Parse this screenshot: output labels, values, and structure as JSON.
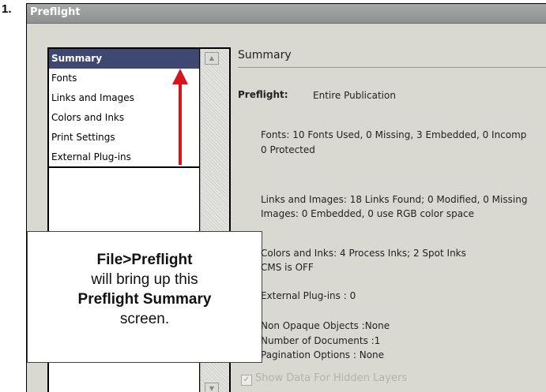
{
  "step_number": "1.",
  "window": {
    "title": "Preflight"
  },
  "sidebar": {
    "items": [
      {
        "label": "Summary"
      },
      {
        "label": "Fonts"
      },
      {
        "label": "Links and Images"
      },
      {
        "label": "Colors and Inks"
      },
      {
        "label": "Print Settings"
      },
      {
        "label": "External Plug-ins"
      }
    ]
  },
  "callout": {
    "line1": "File>Preflight",
    "line2": "will bring up this",
    "line3": "Preflight Summary",
    "line4": "screen."
  },
  "summary": {
    "heading": "Summary",
    "preflight_label": "Preflight:",
    "preflight_value": "Entire Publication",
    "fonts_line1": "Fonts: 10 Fonts Used, 0 Missing, 3 Embedded, 0 Incomp",
    "fonts_line2": "0 Protected",
    "links_line1": "Links and Images: 18 Links Found; 0 Modified, 0 Missing",
    "links_line2": "Images: 0 Embedded, 0 use RGB color space",
    "colors_line1": "Colors and Inks: 4 Process Inks; 2 Spot Inks",
    "colors_line2": "CMS is OFF",
    "plugins_line": "External Plug-ins : 0",
    "non_opaque": "Non Opaque Objects :None",
    "num_documents": "Number of Documents :1",
    "pagination": "Pagination Options : None",
    "hidden_layers_label": "Show Data For Hidden Layers"
  },
  "colors": {
    "selected_bg": "#3e4871",
    "arrow": "#d6151b"
  }
}
